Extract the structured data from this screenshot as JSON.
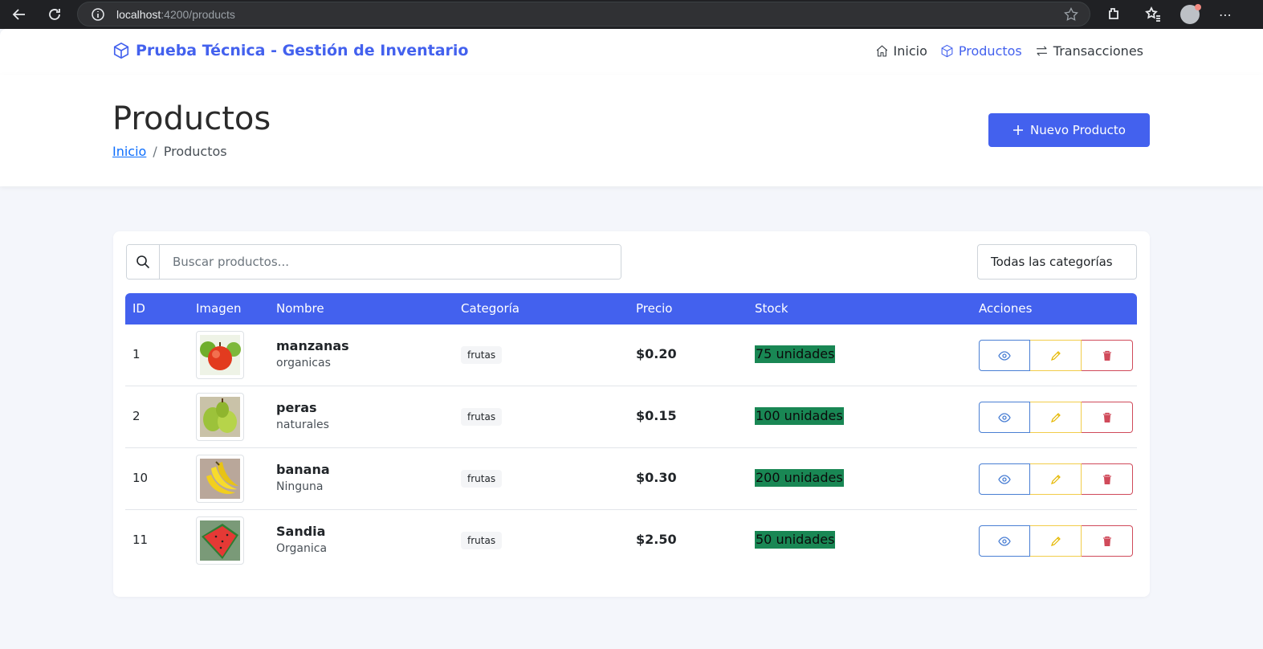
{
  "browser": {
    "url_host": "localhost",
    "url_path": ":4200/products"
  },
  "navbar": {
    "brand": "Prueba Técnica - Gestión de Inventario",
    "links": [
      {
        "label": "Inicio",
        "icon": "home-icon",
        "active": false
      },
      {
        "label": "Productos",
        "icon": "box-icon",
        "active": true
      },
      {
        "label": "Transacciones",
        "icon": "arrows-exchange-icon",
        "active": false
      }
    ]
  },
  "header": {
    "title": "Productos",
    "breadcrumb_home": "Inicio",
    "breadcrumb_sep": "/",
    "breadcrumb_current": "Productos",
    "new_button": "Nuevo Producto"
  },
  "filters": {
    "search_placeholder": "Buscar productos...",
    "category_selected": "Todas las categorías"
  },
  "table": {
    "columns": [
      "ID",
      "Imagen",
      "Nombre",
      "Categoría",
      "Precio",
      "Stock",
      "Acciones"
    ],
    "rows": [
      {
        "id": "1",
        "image": "apple",
        "name": "manzanas",
        "description": "organicas",
        "category": "frutas",
        "price": "$0.20",
        "stock": "75 unidades"
      },
      {
        "id": "2",
        "image": "pear",
        "name": "peras",
        "description": "naturales",
        "category": "frutas",
        "price": "$0.15",
        "stock": "100 unidades"
      },
      {
        "id": "10",
        "image": "banana",
        "name": "banana",
        "description": "Ninguna",
        "category": "frutas",
        "price": "$0.30",
        "stock": "200 unidades"
      },
      {
        "id": "11",
        "image": "watermelon",
        "name": "Sandia",
        "description": "Organica",
        "category": "frutas",
        "price": "$2.50",
        "stock": "50 unidades"
      }
    ]
  },
  "colors": {
    "primary": "#4361ee",
    "stock_badge": "#198754",
    "view_border": "#4a7fd4",
    "edit_border": "#f2cc4a",
    "delete_border": "#d04a5a"
  }
}
